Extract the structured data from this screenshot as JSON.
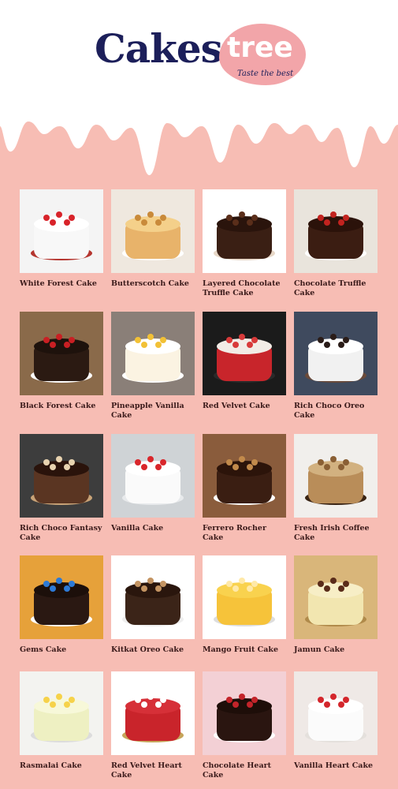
{
  "brand": {
    "name_part1": "Cakes",
    "name_part2": "tree",
    "tagline": "Taste the best"
  },
  "colors": {
    "accent": "#f7bdb4",
    "brand_dark": "#1c1f5a",
    "brand_pink": "#f2a5a9"
  },
  "cakes": [
    {
      "name": "White Forest Cake",
      "bg": "#f4f4f4",
      "cake": "#f8f8f8",
      "top": "#ffffff",
      "plate": "#b5352f",
      "dot": "#d8232a"
    },
    {
      "name": "Butterscotch Cake",
      "bg": "#efe8df",
      "cake": "#e8b36a",
      "top": "#f4d08a",
      "plate": "#ffffff",
      "dot": "#c98a3a"
    },
    {
      "name": "Layered Chocolate Truffle Cake",
      "bg": "#ffffff",
      "cake": "#3a1f14",
      "top": "#2a140c",
      "plate": "#e7d7c7",
      "dot": "#5a2e1a"
    },
    {
      "name": "Chocolate Truffle Cake",
      "bg": "#e9e4dc",
      "cake": "#3b1d12",
      "top": "#2b120a",
      "plate": "#ffffff",
      "dot": "#c2231f"
    },
    {
      "name": "Black Forest Cake",
      "bg": "#8a6a4a",
      "cake": "#2b1a12",
      "top": "#1e120c",
      "plate": "#ffffff",
      "dot": "#c91f23"
    },
    {
      "name": "Pineapple Vanilla Cake",
      "bg": "#8a7f78",
      "cake": "#fbf3e2",
      "top": "#ffffff",
      "plate": "#ffffff",
      "dot": "#f2c136"
    },
    {
      "name": "Red Velvet Cake",
      "bg": "#1b1b1b",
      "cake": "#c8252b",
      "top": "#f2ece6",
      "plate": "#2a2a2a",
      "dot": "#d83a3a"
    },
    {
      "name": "Rich Choco Oreo Cake",
      "bg": "#3f4a5e",
      "cake": "#f1f1f1",
      "top": "#ffffff",
      "plate": "#6a4a3a",
      "dot": "#2a1c18"
    },
    {
      "name": "Rich Choco Fantasy Cake",
      "bg": "#3d3d3d",
      "cake": "#5a3522",
      "top": "#2a130b",
      "plate": "#c9a377",
      "dot": "#e8d3b0"
    },
    {
      "name": "Vanilla Cake",
      "bg": "#cfd3d6",
      "cake": "#fafafa",
      "top": "#ffffff",
      "plate": "#e8eaec",
      "dot": "#d9262b"
    },
    {
      "name": "Ferrero Rocher Cake",
      "bg": "#8a5c3c",
      "cake": "#3a1e12",
      "top": "#2c140a",
      "plate": "#ffffff",
      "dot": "#c28a4b"
    },
    {
      "name": "Fresh Irish Coffee Cake",
      "bg": "#f1efec",
      "cake": "#b98d59",
      "top": "#d2b180",
      "plate": "#3a2414",
      "dot": "#8a5f34"
    },
    {
      "name": "Gems Cake",
      "bg": "#e6a13a",
      "cake": "#2a1812",
      "top": "#1c0f0a",
      "plate": "#ffffff",
      "dot": "#2d7ad6"
    },
    {
      "name": "Kitkat Oreo Cake",
      "bg": "#ffffff",
      "cake": "#3b2418",
      "top": "#2a160d",
      "plate": "#eeeeee",
      "dot": "#c49462"
    },
    {
      "name": "Mango Fruit Cake",
      "bg": "#ffffff",
      "cake": "#f6c33a",
      "top": "#f9d24e",
      "plate": "#dddddd",
      "dot": "#ffe9a8"
    },
    {
      "name": "Jamun Cake",
      "bg": "#d9b67a",
      "cake": "#f2e6b0",
      "top": "#f7eec6",
      "plate": "#b08a4a",
      "dot": "#5a2c1a"
    },
    {
      "name": "Rasmalai Cake",
      "bg": "#f3f3f0",
      "cake": "#eef0c2",
      "top": "#f7f8d9",
      "plate": "#dcdcdc",
      "dot": "#f6d24a"
    },
    {
      "name": "Red Velvet Heart Cake",
      "bg": "#ffffff",
      "cake": "#c9242b",
      "top": "#d63038",
      "plate": "#c6a55a",
      "dot": "#ffffff"
    },
    {
      "name": "Chocolate Heart Cake",
      "bg": "#f3d0d5",
      "cake": "#2a1510",
      "top": "#1e0e09",
      "plate": "#ffffff",
      "dot": "#c3242a"
    },
    {
      "name": "Vanilla Heart Cake",
      "bg": "#efe9e6",
      "cake": "#fbfbfb",
      "top": "#ffffff",
      "plate": "#e4e0dc",
      "dot": "#d4262c"
    }
  ]
}
